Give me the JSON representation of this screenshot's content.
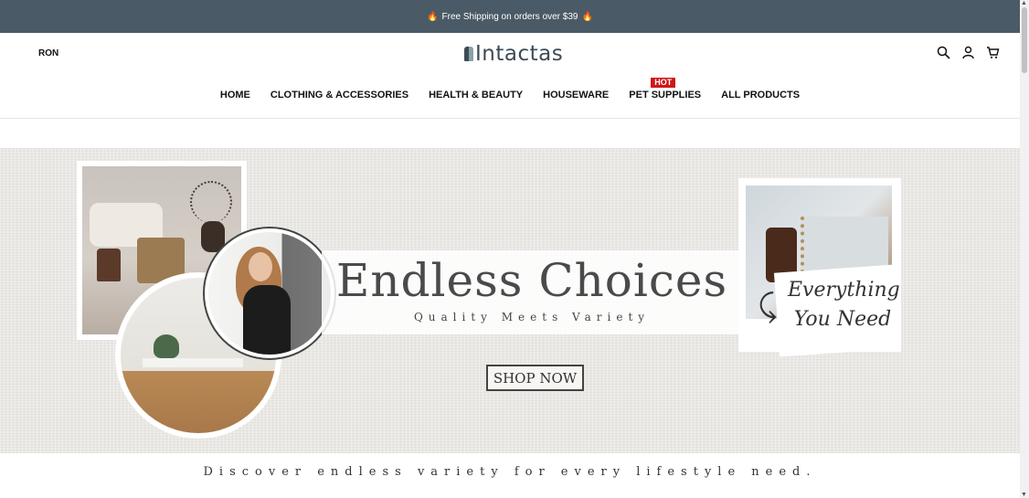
{
  "announcement": {
    "text": "Free Shipping on orders over $39",
    "icon": "flame-icon"
  },
  "header": {
    "currency": "RON",
    "logo": "Intactas",
    "icons": [
      "search-icon",
      "user-icon",
      "cart-icon"
    ]
  },
  "nav": {
    "items": [
      {
        "label": "HOME"
      },
      {
        "label": "CLOTHING & ACCESSORIES"
      },
      {
        "label": "HEALTH & BEAUTY"
      },
      {
        "label": "HOUSEWARE"
      },
      {
        "label": "PET SUPPLIES",
        "badge": "HOT"
      },
      {
        "label": "ALL PRODUCTS"
      }
    ]
  },
  "banner": {
    "title": "Endless Choices",
    "subtitle": "Quality Meets Variety",
    "button": "SHOP NOW",
    "script_line1": "Everything",
    "script_line2": "You Need"
  },
  "tagline": "Discover endless variety for every lifestyle need.",
  "colors": {
    "announcement_bg": "#4a5a66",
    "hot_badge": "#d01616",
    "logo": "#3d4b55"
  }
}
